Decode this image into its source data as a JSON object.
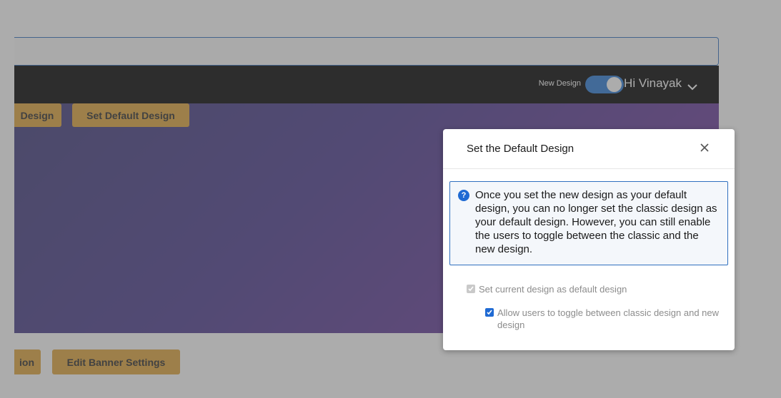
{
  "header": {
    "new_design_label": "New Design",
    "toggle_on": true,
    "greeting": "Hi Vinayak"
  },
  "page_buttons": {
    "design_partial": "Design",
    "set_default": "Set Default Design",
    "ion_partial": "ion",
    "edit_banner": "Edit Banner Settings"
  },
  "modal": {
    "title": "Set the Default Design",
    "info_icon": "?",
    "info_text": "Once you set the new design as your default design, you can no longer set the classic design as your default design. However, you can still enable the users to toggle between the classic and the new design.",
    "checkboxes": [
      {
        "label": "Set current design as default design",
        "checked": true,
        "disabled": true
      },
      {
        "label": "Allow users to toggle between classic design and new design",
        "checked": true,
        "disabled": false
      }
    ]
  },
  "colors": {
    "accent": "#1f6ad3",
    "gold_button": "#e0a53a",
    "header_bg": "#000000"
  },
  "icons": [
    "chevron-down-icon",
    "close-icon",
    "question-icon",
    "checkmark-icon"
  ]
}
